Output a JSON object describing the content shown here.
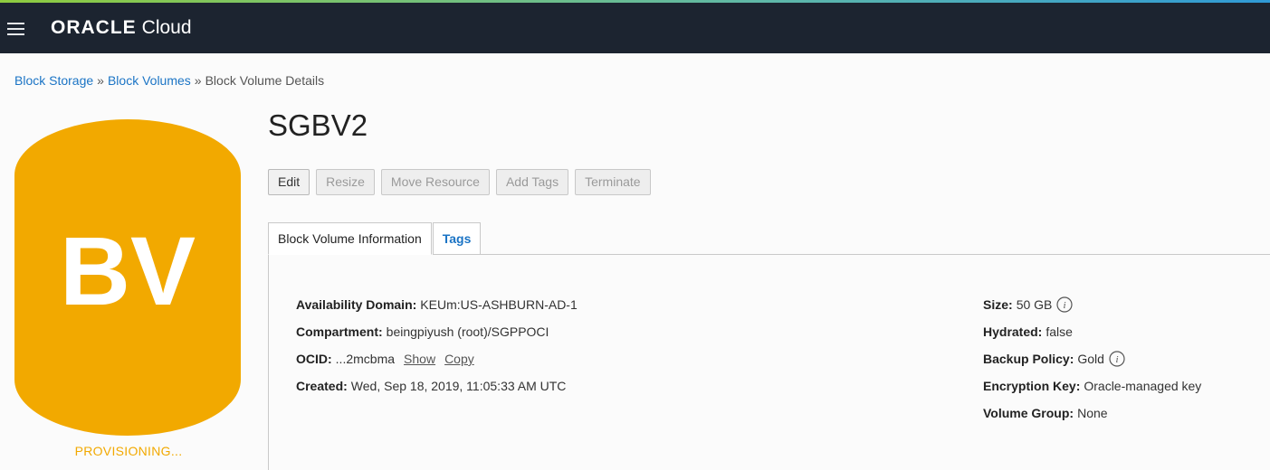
{
  "header": {
    "brand_oracle": "ORACLE",
    "brand_cloud": "Cloud",
    "menu_icon": "hamburger-icon"
  },
  "breadcrumb": {
    "items": [
      "Block Storage",
      "Block Volumes",
      "Block Volume Details"
    ],
    "separator": "»"
  },
  "volume_icon": {
    "text": "BV",
    "color": "#f2a900",
    "status": "PROVISIONING..."
  },
  "title": "SGBV2",
  "actions": {
    "edit": "Edit",
    "resize": "Resize",
    "move_resource": "Move Resource",
    "add_tags": "Add Tags",
    "terminate": "Terminate"
  },
  "tabs": {
    "info": "Block Volume Information",
    "tags": "Tags"
  },
  "details_left": {
    "availability_domain": {
      "label": "Availability Domain:",
      "value": "KEUm:US-ASHBURN-AD-1"
    },
    "compartment": {
      "label": "Compartment:",
      "value": "beingpiyush (root)/SGPPOCI"
    },
    "ocid": {
      "label": "OCID:",
      "value": "...2mcbma",
      "show": "Show",
      "copy": "Copy"
    },
    "created": {
      "label": "Created:",
      "value": "Wed, Sep 18, 2019, 11:05:33 AM UTC"
    }
  },
  "details_right": {
    "size": {
      "label": "Size:",
      "value": "50 GB"
    },
    "hydrated": {
      "label": "Hydrated:",
      "value": "false"
    },
    "backup_policy": {
      "label": "Backup Policy:",
      "value": "Gold"
    },
    "encryption_key": {
      "label": "Encryption Key:",
      "value": "Oracle-managed key"
    },
    "volume_group": {
      "label": "Volume Group:",
      "value": "None"
    }
  },
  "colors": {
    "header_bg": "#1c2430",
    "link": "#1b74c5",
    "accent": "#f2a900"
  }
}
